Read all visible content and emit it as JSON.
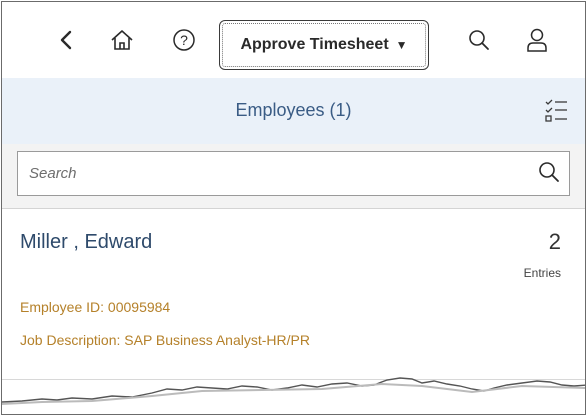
{
  "shell": {
    "app_title": "Approve Timesheet",
    "icons": [
      "back-icon",
      "home-icon",
      "help-icon",
      "search-icon",
      "user-icon"
    ]
  },
  "subheader": {
    "title": "Employees (1)",
    "action_icon": "multi-select-icon"
  },
  "search": {
    "placeholder": "Search",
    "value": ""
  },
  "employees": [
    {
      "name": "Miller , Edward",
      "entries_count": "2",
      "entries_label": "Entries",
      "employee_id": "Employee ID: 00095984",
      "job_description": "Job Description: SAP Business Analyst-HR/PR"
    }
  ],
  "colors": {
    "accent": "#3a5c85",
    "subheader_bg": "#eaf1f9",
    "attribute_text": "#b5812a"
  }
}
